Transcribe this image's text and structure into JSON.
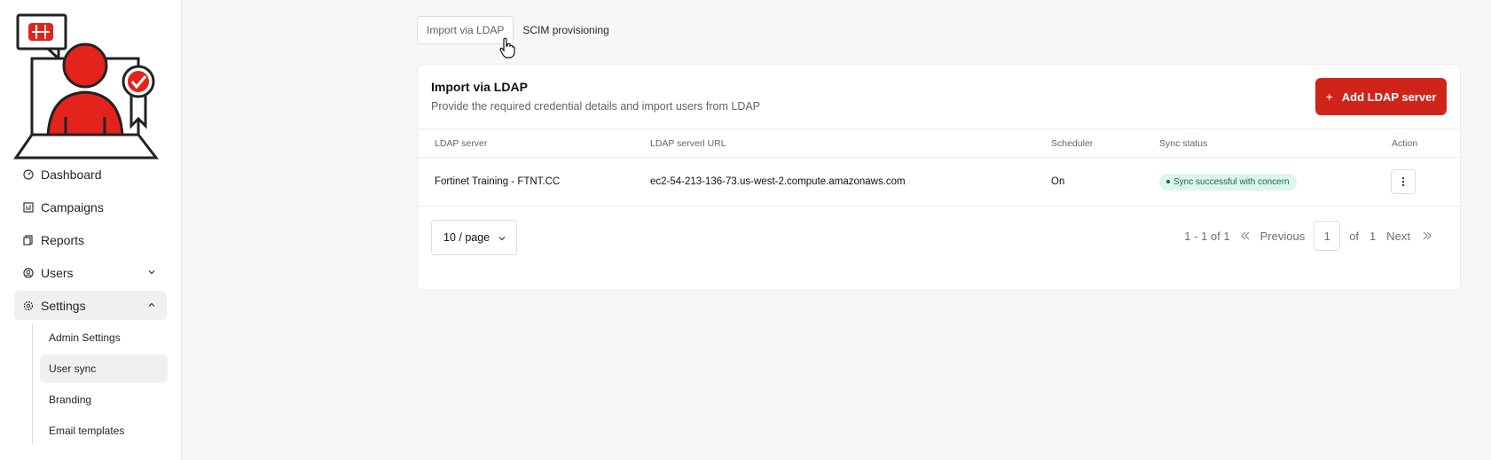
{
  "colors": {
    "accent": "#d0241b",
    "badge_bg": "#ddf6ec",
    "badge_text": "#17694a"
  },
  "sidebar": {
    "items": [
      {
        "label": "Dashboard",
        "icon": "dashboard-icon"
      },
      {
        "label": "Campaigns",
        "icon": "campaigns-icon"
      },
      {
        "label": "Reports",
        "icon": "reports-icon"
      },
      {
        "label": "Users",
        "icon": "users-icon"
      },
      {
        "label": "Settings",
        "icon": "settings-icon"
      }
    ],
    "settings_sub": [
      "Admin Settings",
      "User sync",
      "Branding",
      "Email templates"
    ]
  },
  "tabs": [
    "Import via LDAP",
    "SCIM provisioning"
  ],
  "card": {
    "title": "Import via LDAP",
    "subtitle": "Provide the required credential details and import users from LDAP",
    "add_button": "Add LDAP server"
  },
  "table": {
    "headers": [
      "LDAP server",
      "LDAP serverl URL",
      "Scheduler",
      "Sync status",
      "Action"
    ],
    "rows": [
      {
        "server": "Fortinet Training - FTNT.CC",
        "url": "ec2-54-213-136-73.us-west-2.compute.amazonaws.com",
        "scheduler": "On",
        "status": "Sync successful with concern"
      }
    ]
  },
  "pagination": {
    "page_size": "10 / page",
    "range": "1 - 1 of 1",
    "previous": "Previous",
    "current_page": "1",
    "of": "of",
    "total_pages": "1",
    "next": "Next"
  }
}
